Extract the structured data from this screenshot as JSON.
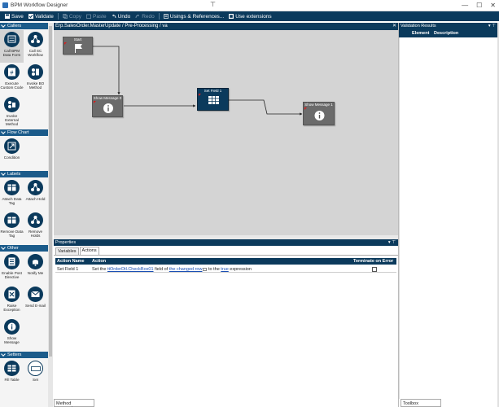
{
  "window": {
    "title": "BPM Workflow Designer",
    "pin_glyph": "⊤",
    "controls": [
      "—",
      "☐",
      "✕"
    ]
  },
  "toolbar": {
    "save": "Save",
    "validate": "Validate",
    "copy": "Copy",
    "paste": "Paste",
    "undo": "Undo",
    "redo": "Redo",
    "usings": "Usings & References...",
    "use_extensions": "Use extensions"
  },
  "palette": {
    "sections": [
      {
        "title": "Callers",
        "items": [
          "Call BPM Data Form",
          "Call SC Workflow",
          "Execute Custom Code",
          "Invoke BO Method",
          "Invoke External Method"
        ]
      },
      {
        "title": "Flow Chart",
        "items": [
          "Condition"
        ]
      },
      {
        "title": "Labels",
        "items": [
          "Attach Data Tag",
          "Attach Hold",
          "Remove Data Tag",
          "Remove Holds"
        ]
      },
      {
        "title": "Other",
        "items": [
          "Enable Post Directive",
          "Notify Me",
          "Raise Exception",
          "Send E-mail",
          "Show Message"
        ]
      },
      {
        "title": "Setters",
        "items": [
          "Fill Table",
          "Set"
        ]
      }
    ]
  },
  "designer_tab": {
    "label": "Erp.SalesOrder.MasterUpdate / Pre-Processing / va",
    "close": "✕"
  },
  "nodes": {
    "start": "Start",
    "show_message_0": "Show Message 0",
    "set_field_1": "Set Field 1",
    "show_message_1": "Show Message 1"
  },
  "properties": {
    "header": "Properties",
    "pin": "▾ ⊤",
    "tabs": [
      "Variables",
      "Actions"
    ],
    "columns": {
      "action_name": "Action Name",
      "action": "Action",
      "terminate": "Terminate on Error"
    },
    "row": {
      "name": "Set Field 1",
      "pre": "Set the ",
      "field": "ttOrderDtl.CheckBox01",
      "mid1": " field of ",
      "target": "the changed row",
      "mid2": " to the ",
      "value": "true",
      "suffix": " expression"
    },
    "bottom_tab": "Method parameters"
  },
  "validation": {
    "header": "Validation Results",
    "pin": "▾ ⊤",
    "columns": {
      "element": "Element",
      "description": "Description"
    },
    "bottom_tab": "Toolbox"
  }
}
